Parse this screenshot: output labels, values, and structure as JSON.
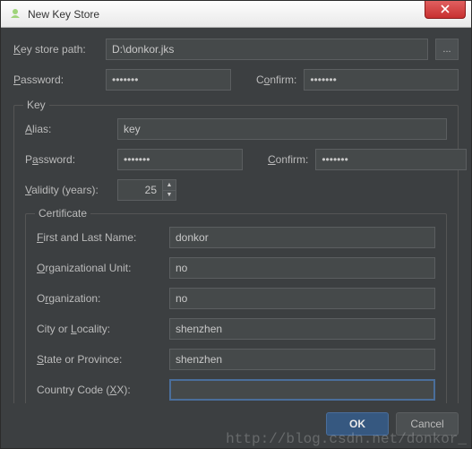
{
  "window": {
    "title": "New Key Store"
  },
  "keystore": {
    "path_label": "Key store path:",
    "path_value": "D:\\donkor.jks",
    "browse_label": "...",
    "password_label": "Password:",
    "password_value": "•••••••",
    "confirm_label": "Confirm:",
    "confirm_value": "•••••••"
  },
  "key_section": {
    "legend": "Key",
    "alias_label": "Alias:",
    "alias_value": "key",
    "password_label": "Password:",
    "password_value": "•••••••",
    "confirm_label": "Confirm:",
    "confirm_value": "•••••••",
    "validity_label": "Validity (years):",
    "validity_value": "25"
  },
  "certificate": {
    "legend": "Certificate",
    "first_last_label": "First and Last Name:",
    "first_last_value": "donkor",
    "org_unit_label": "Organizational Unit:",
    "org_unit_value": "no",
    "org_label": "Organization:",
    "org_value": "no",
    "city_label": "City or Locality:",
    "city_value": "shenzhen",
    "state_label": "State or Province:",
    "state_value": "shenzhen",
    "country_label": "Country Code (XX):",
    "country_value": ""
  },
  "footer": {
    "ok": "OK",
    "cancel": "Cancel"
  },
  "watermark": "http://blog.csdn.net/donkor_"
}
